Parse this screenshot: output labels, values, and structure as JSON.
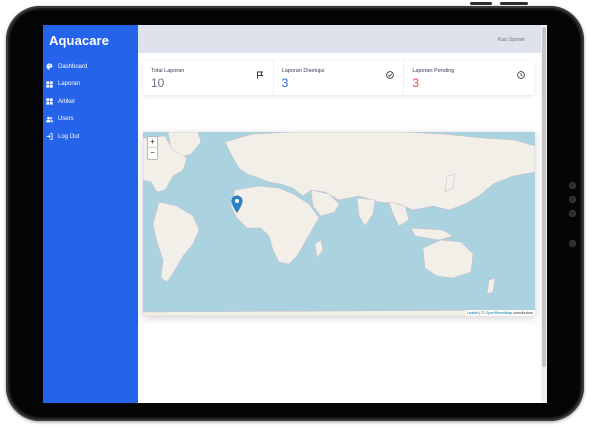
{
  "app": {
    "brand": "Aquacare"
  },
  "sidebar": {
    "items": [
      {
        "label": "Dashboard",
        "icon": "palette-icon"
      },
      {
        "label": "Laporan",
        "icon": "grid-icon"
      },
      {
        "label": "Artikel",
        "icon": "grid-icon"
      },
      {
        "label": "Users",
        "icon": "users-icon"
      },
      {
        "label": "Log Out",
        "icon": "logout-icon"
      }
    ]
  },
  "header": {
    "username": "Kaci Sponer"
  },
  "stats": [
    {
      "label": "Total Laporan",
      "value": "10",
      "color": "#6b7280",
      "icon": "flag-icon"
    },
    {
      "label": "Laporan Disetujui",
      "value": "3",
      "color": "#2563eb",
      "icon": "check-circle-icon"
    },
    {
      "label": "Laporan Pending",
      "value": "3",
      "color": "#ef4444",
      "icon": "clock-icon"
    }
  ],
  "map": {
    "zoom_in": "+",
    "zoom_out": "−",
    "attribution_leaflet": "Leaflet",
    "attribution_sep": " | © ",
    "attribution_osm": "OpenStreetMap",
    "attribution_tail": " contributors"
  },
  "colors": {
    "sidebar": "#2563eb",
    "ocean": "#abd3df",
    "land": "#f2efe9",
    "topbar": "#dde2ec"
  }
}
